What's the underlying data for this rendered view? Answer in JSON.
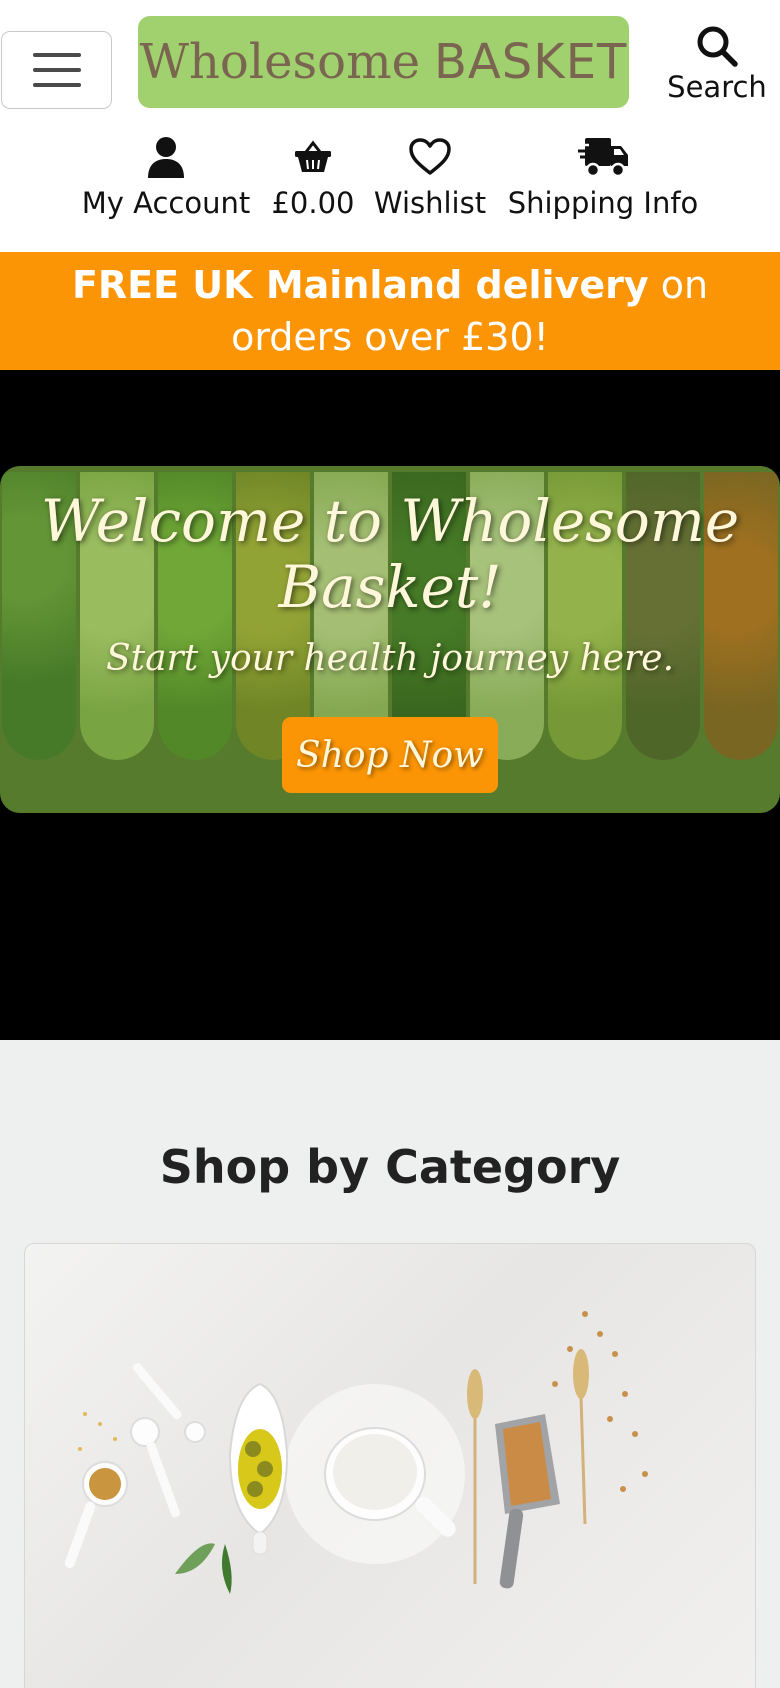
{
  "header": {
    "menu_label": "menu",
    "logo": {
      "script_text": "Wholesome",
      "caps_text": "BASKET"
    },
    "search_label": "Search"
  },
  "nav": {
    "account": "My Account",
    "basket_total": "£0.00",
    "wishlist": "Wishlist",
    "shipping": "Shipping Info"
  },
  "promo": {
    "bold": "FREE UK Mainland delivery",
    "line1_rest": "on",
    "line2": "orders over £30!"
  },
  "hero": {
    "title": "Welcome to Wholesome Basket!",
    "subtitle": "Start your health journey here.",
    "cta": "Shop Now"
  },
  "categories": {
    "title": "Shop by Category"
  },
  "colors": {
    "logo_bg": "#a1d06e",
    "accent_orange": "#fb9505",
    "hero_green": "#567b2c",
    "logo_text": "#7a6650"
  }
}
